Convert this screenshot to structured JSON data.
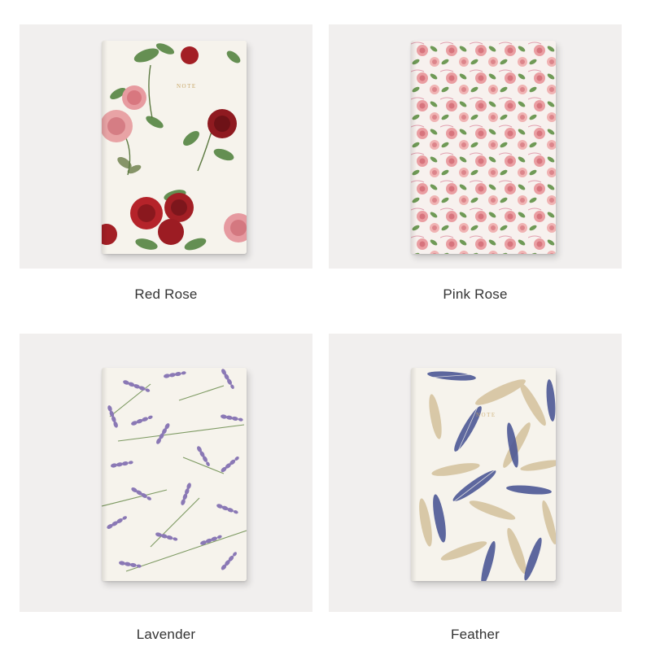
{
  "products": [
    {
      "label": "Red Rose",
      "pattern": "red-rose-pattern"
    },
    {
      "label": "Pink Rose",
      "pattern": "pink-rose-pattern"
    },
    {
      "label": "Lavender",
      "pattern": "lavender-pattern"
    },
    {
      "label": "Feather",
      "pattern": "feather-pattern"
    }
  ],
  "cover_text": "NOTE",
  "colors": {
    "background": "#ffffff",
    "photo_background": "#f1efee",
    "cover": "#f6f3ec",
    "red_rose": "#a31f25",
    "pink_rose": "#e79ba0",
    "leaf_green": "#5d8a4a",
    "lavender": "#8a78b5",
    "feather_blue": "#4d5896",
    "feather_tan": "#d7c6a4",
    "caption_text": "#333333"
  }
}
